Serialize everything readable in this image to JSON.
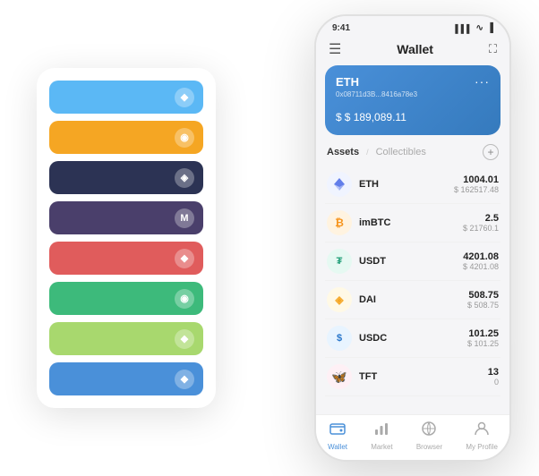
{
  "scene": {
    "bgCard": {
      "bars": [
        {
          "color": "bar-1",
          "icon": "◆"
        },
        {
          "color": "bar-2",
          "icon": "◉"
        },
        {
          "color": "bar-3",
          "icon": "◈"
        },
        {
          "color": "bar-4",
          "icon": "M"
        },
        {
          "color": "bar-5",
          "icon": "◆"
        },
        {
          "color": "bar-6",
          "icon": "◉"
        },
        {
          "color": "bar-7",
          "icon": "◆"
        },
        {
          "color": "bar-8",
          "icon": "◆"
        }
      ]
    },
    "phone": {
      "statusBar": {
        "time": "9:41",
        "signal": "▌▌▌",
        "wifi": "WiFi",
        "battery": "🔋"
      },
      "navBar": {
        "menuIcon": "☰",
        "title": "Wallet",
        "expandIcon": "⛶"
      },
      "ethCard": {
        "title": "ETH",
        "address": "0x08711d3B...8416a78e3",
        "copyIcon": "⧉",
        "balance": "$ 189,089.11",
        "currencySymbol": "$",
        "moreIcon": "..."
      },
      "assetsSection": {
        "tabs": [
          {
            "label": "Assets",
            "active": true
          },
          {
            "label": "Collectibles",
            "active": false
          }
        ],
        "separator": "/",
        "addLabel": "+"
      },
      "assets": [
        {
          "name": "ETH",
          "amount": "1004.01",
          "usd": "$ 162517.48",
          "iconEmoji": "🔷",
          "iconClass": "icon-eth"
        },
        {
          "name": "imBTC",
          "amount": "2.5",
          "usd": "$ 21760.1",
          "iconEmoji": "₿",
          "iconClass": "icon-imbtc"
        },
        {
          "name": "USDT",
          "amount": "4201.08",
          "usd": "$ 4201.08",
          "iconEmoji": "₮",
          "iconClass": "icon-usdt"
        },
        {
          "name": "DAI",
          "amount": "508.75",
          "usd": "$ 508.75",
          "iconEmoji": "◈",
          "iconClass": "icon-dai"
        },
        {
          "name": "USDC",
          "amount": "101.25",
          "usd": "$ 101.25",
          "iconEmoji": "💲",
          "iconClass": "icon-usdc"
        },
        {
          "name": "TFT",
          "amount": "13",
          "usd": "0",
          "iconEmoji": "🦋",
          "iconClass": "icon-tft"
        }
      ],
      "bottomNav": [
        {
          "label": "Wallet",
          "icon": "◉",
          "active": true
        },
        {
          "label": "Market",
          "icon": "📊",
          "active": false
        },
        {
          "label": "Browser",
          "icon": "👤",
          "active": false
        },
        {
          "label": "My Profile",
          "icon": "👤",
          "active": false
        }
      ]
    }
  }
}
